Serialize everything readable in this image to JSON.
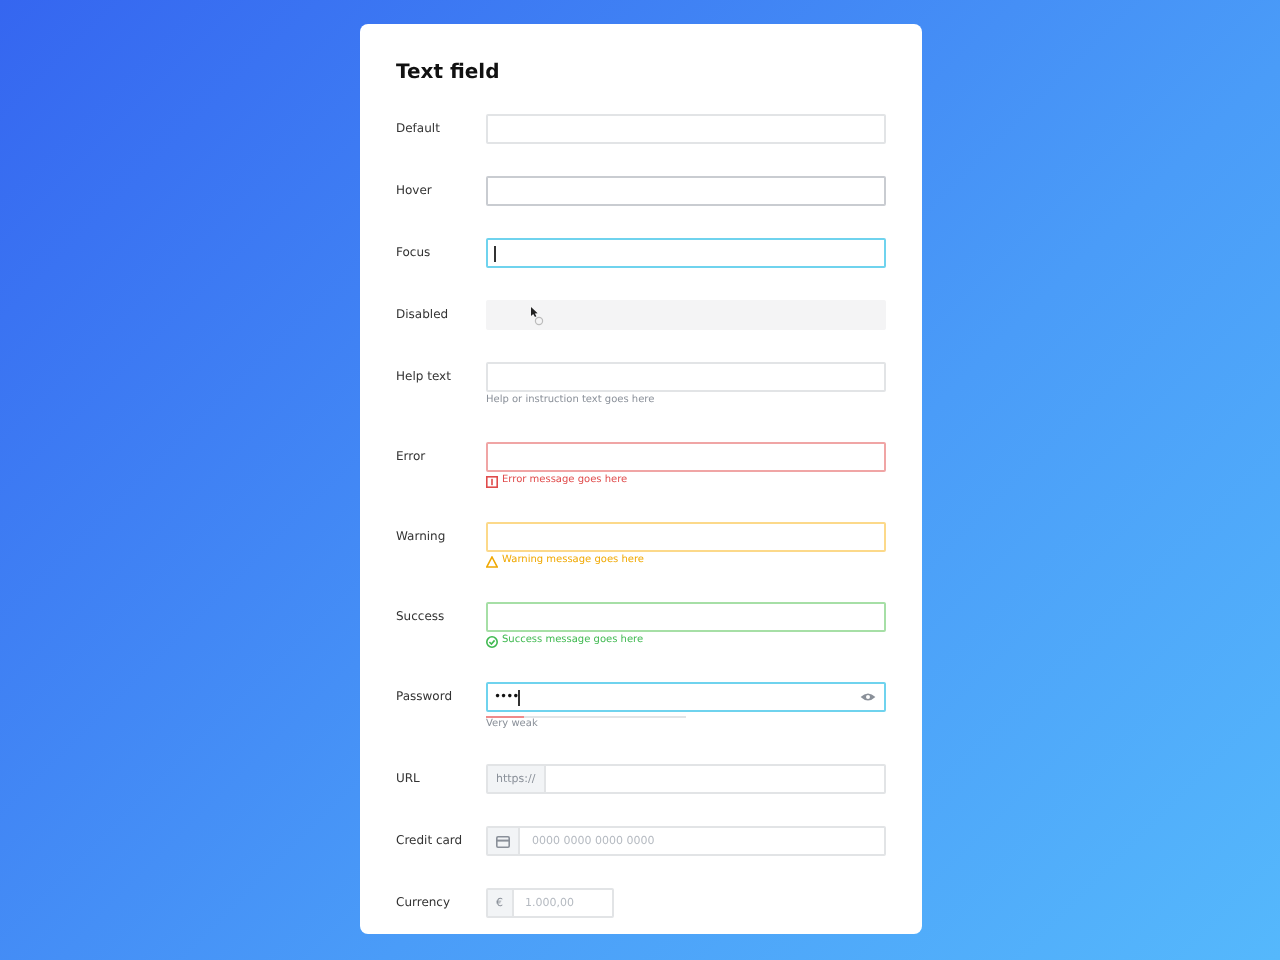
{
  "title": "Text field",
  "fields": [
    {
      "label": "Default",
      "kind": "default"
    },
    {
      "label": "Hover",
      "kind": "hover"
    },
    {
      "label": "Focus",
      "kind": "focus",
      "caret": true
    },
    {
      "label": "Disabled",
      "kind": "disabled",
      "pointer": true
    },
    {
      "label": "Help text",
      "kind": "default",
      "message": {
        "kind": "help",
        "text": "Help or instruction text goes here"
      }
    },
    {
      "label": "Error",
      "kind": "error",
      "message": {
        "kind": "error",
        "text": "Error message goes here"
      }
    },
    {
      "label": "Warning",
      "kind": "warning",
      "message": {
        "kind": "warning",
        "text": "Warning message goes here"
      }
    },
    {
      "label": "Success",
      "kind": "success",
      "message": {
        "kind": "success",
        "text": "Success message goes here"
      }
    },
    {
      "label": "Password",
      "kind": "focus",
      "value": "••••",
      "caret": true,
      "reveal_toggle": true,
      "strength": {
        "level": 0.19,
        "text": "Very weak"
      }
    },
    {
      "label": "URL",
      "kind": "default",
      "addon": {
        "kind": "text",
        "text": "https://"
      }
    },
    {
      "label": "Credit card",
      "kind": "default",
      "addon": {
        "kind": "card"
      },
      "placeholder": "0000 0000 0000 0000"
    },
    {
      "label": "Currency",
      "kind": "default",
      "compact": true,
      "addon": {
        "kind": "text",
        "text": "€"
      },
      "placeholder": "1.000,00"
    }
  ]
}
